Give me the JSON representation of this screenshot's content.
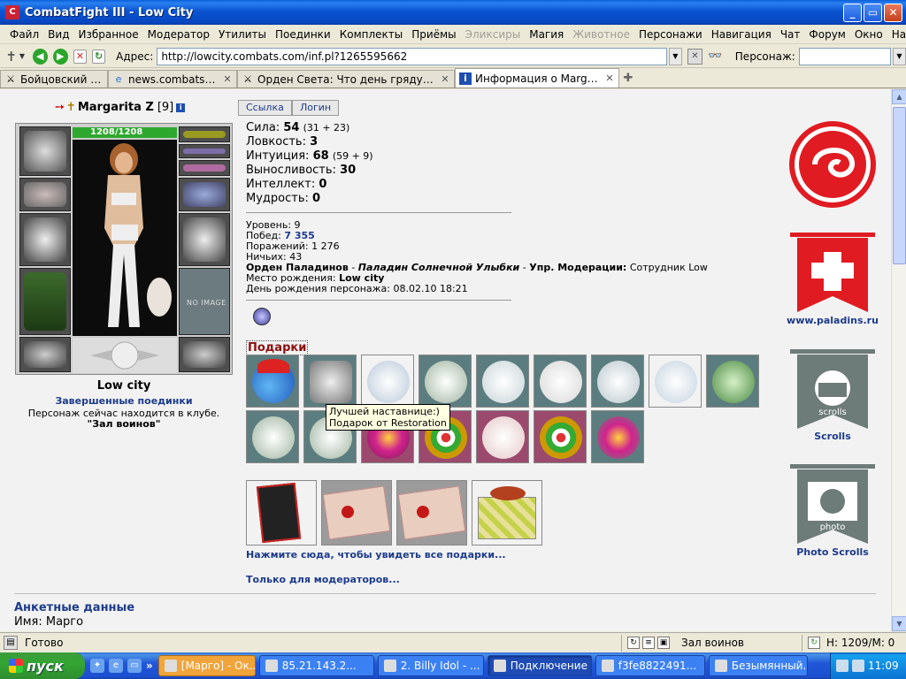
{
  "window": {
    "title": "CombatFight III - Low City"
  },
  "menu": [
    "Файл",
    "Вид",
    "Избранное",
    "Модератор",
    "Утилиты",
    "Поединки",
    "Комплекты",
    "Приёмы",
    "Эликсиры",
    "Магия",
    "Животное",
    "Персонажи",
    "Навигация",
    "Чат",
    "Форум",
    "Окно",
    "Настройки",
    "?"
  ],
  "menu_disabled": [
    false,
    false,
    false,
    false,
    false,
    false,
    false,
    false,
    true,
    false,
    true,
    false,
    false,
    false,
    false,
    false,
    false,
    false
  ],
  "address": {
    "label": "Адрес:",
    "url": "http://lowcity.combats.com/inf.pl?1265595662"
  },
  "persona": {
    "label": "Персонаж:",
    "value": ""
  },
  "tabs": [
    {
      "label": "Бойцовский клуб",
      "active": false
    },
    {
      "label": "news.combats.com",
      "active": false
    },
    {
      "label": "Орден Света: Что день грядущий на...",
      "active": false
    },
    {
      "label": "Информация о Margarita Z",
      "active": true
    }
  ],
  "buttons": {
    "link": "Ссылка",
    "login": "Логин"
  },
  "character": {
    "name": "Margarita Z",
    "level": "[9]",
    "hp": "1208/1208",
    "no_image": "NO IMAGE",
    "location": "Low city",
    "completed_fights": "Завершенные поединки",
    "in_club": "Персонаж сейчас находится в клубе.",
    "room": "\"Зал воинов\""
  },
  "stats": [
    {
      "label": "Сила:",
      "value": "54",
      "detail": "(31 + 23)"
    },
    {
      "label": "Ловкость:",
      "value": "3",
      "detail": ""
    },
    {
      "label": "Интуиция:",
      "value": "68",
      "detail": "(59 + 9)"
    },
    {
      "label": "Выносливость:",
      "value": "30",
      "detail": ""
    },
    {
      "label": "Интеллект:",
      "value": "0",
      "detail": ""
    },
    {
      "label": "Мудрость:",
      "value": "0",
      "detail": ""
    }
  ],
  "info": {
    "level_label": "Уровень:",
    "level": "9",
    "wins_label": "Побед:",
    "wins": "7 355",
    "losses_label": "Поражений:",
    "losses": "1 276",
    "draws_label": "Ничьих:",
    "draws": "43",
    "order_label": "Орден Паладинов",
    "order_dash": " - ",
    "order_title": "Паладин Солнечной Улыбки",
    "order_sep": " - ",
    "moder_label": "Упр. Модерации:",
    "moder_value": "Сотрудник Low",
    "birthplace_label": "Место рождения:",
    "birthplace": "Low city",
    "birthday_label": "День рождения персонажа:",
    "birthday": "08.02.10 18:21"
  },
  "gifts": {
    "title": "Подарки",
    "tooltip_line1": "Лучшей наставнице:)",
    "tooltip_line2": "Подарок от Restoration",
    "see_all": "Нажмите сюда, чтобы увидеть все подарки...",
    "moderators_only": "Только для модераторов..."
  },
  "profile": {
    "title": "Анкетные данные",
    "name_line": "Имя: Марго"
  },
  "right_links": {
    "paladins": "www.paladins.ru",
    "scrolls": "Scrolls",
    "photo_scrolls": "Photo Scrolls",
    "scrolls_sign": "scrolls",
    "photo_sign": "photo"
  },
  "status": {
    "text": "Готово",
    "room": "Зал воинов",
    "hp": "H: 1209/М: 0"
  },
  "taskbar": {
    "start": "пуск",
    "buttons": [
      {
        "label": "[Марго] - Ок...",
        "style": "amber"
      },
      {
        "label": "85.21.143.2...",
        "style": ""
      },
      {
        "label": "2. Billy Idol - ...",
        "style": ""
      },
      {
        "label": "Подключение",
        "style": "active"
      },
      {
        "label": "f3fe8822491...",
        "style": ""
      },
      {
        "label": "Безымянный...",
        "style": ""
      }
    ],
    "clock": "11:09"
  },
  "colors": {
    "title_blue": "#0a54d2",
    "link_blue": "#1c3b8a",
    "hp_green": "#2ea82e",
    "gifts_red": "#8a1010",
    "paladin_red": "#e11b22",
    "scroll_gray": "#6d7b79"
  }
}
